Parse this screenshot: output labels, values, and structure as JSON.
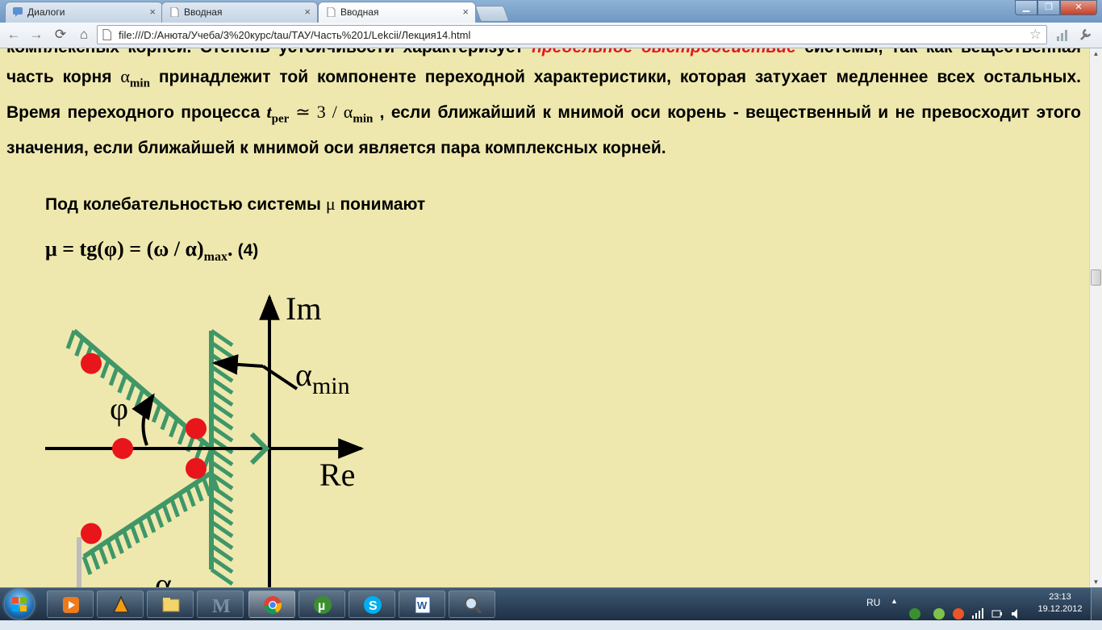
{
  "tabs": [
    {
      "label": "Диалоги",
      "close": "×"
    },
    {
      "label": "Вводная",
      "close": "×"
    },
    {
      "label": "Вводная",
      "close": "×"
    }
  ],
  "toolbar": {
    "back": "←",
    "forward": "→",
    "reload": "⟳",
    "home": "⌂",
    "url": "file:///D:/Анюта/Учеба/3%20курс/tau/ТАУ/Часть%201/Lekcii/Лекция14.html",
    "star": "☆"
  },
  "content": {
    "p1": "комплексных корней. Степень устойчивости характеризует",
    "p1_red": "предельное быстродействие",
    "p1b": "системы,",
    "p2a": "так как вещественная часть корня",
    "p2_sym": "α",
    "p2_sub": "min",
    "p2b": "принадлежит той компоненте переходной характеристики,",
    "p3a": "которая затухает медленнее всех остальных. Время переходного процесса",
    "p3_t": "t",
    "p3_tsub": "per",
    "p3_rel": " ≃ 3 / α",
    "p3_relsub": "min",
    "p3b": ", если",
    "p4": "ближайший к мнимой оси корень - вещественный и не превосходит этого значения, если ближайшей",
    "p5": "к мнимой оси является пара комплексных корней.",
    "lead_text": "Под колебательностью системы",
    "lead_mu": "μ",
    "lead_text2": "понимают",
    "formula_main": "μ = tg(φ) = (ω / α)",
    "formula_sub": "max",
    "formula_dot": ".",
    "formula_num": "(4)"
  },
  "diagram": {
    "im_label": "Im",
    "re_label": "Re",
    "phi_label": "φ",
    "alpha_label": "α",
    "alpha_sub": "min",
    "alpha_bottom": "α",
    "hatch_color": "#3f9768",
    "root_color": "#e8151b",
    "roots": [
      {
        "re": -3.4,
        "im": 1.7
      },
      {
        "re": -1.4,
        "im": 0.4
      },
      {
        "re": -2.8,
        "im": 0.0
      },
      {
        "re": -1.4,
        "im": -0.4
      },
      {
        "re": -3.4,
        "im": -1.7
      }
    ]
  },
  "taskbar": {
    "apps": [
      "winamp-icon",
      "vlc-icon",
      "explorer-icon",
      "mathcad-icon",
      "chrome-icon",
      "utorrent-icon",
      "skype-icon",
      "word-icon",
      "magnifier-icon"
    ],
    "lang": "RU",
    "time": "23:13",
    "date": "19.12.2012"
  }
}
